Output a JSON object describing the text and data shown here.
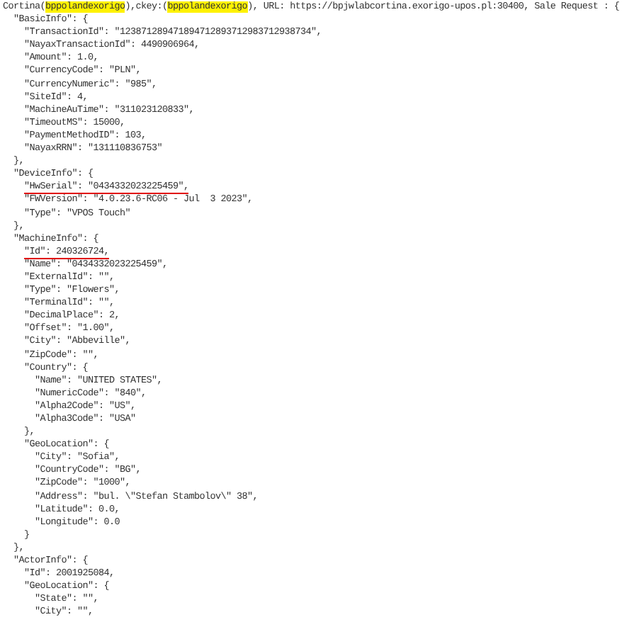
{
  "header": [
    {
      "text": "Cortina(",
      "highlighted": false
    },
    {
      "text": "bppolandexorigo",
      "highlighted": true
    },
    {
      "text": "),ckey:(",
      "highlighted": false
    },
    {
      "text": "bppolandexorigo",
      "highlighted": true
    },
    {
      "text": "), URL: https://bpjwlabcortina.exorigo-upos.pl:30400, Sale Request : {",
      "highlighted": false
    }
  ],
  "lines": [
    {
      "text": "  \"BasicInfo\": {",
      "underlined": false
    },
    {
      "text": "    \"TransactionId\": \"123871289471894712893712983712938734\",",
      "underlined": false
    },
    {
      "text": "    \"NayaxTransactionId\": 4490906964,",
      "underlined": false
    },
    {
      "text": "    \"Amount\": 1.0,",
      "underlined": false
    },
    {
      "text": "    \"CurrencyCode\": \"PLN\",",
      "underlined": false
    },
    {
      "text": "    \"CurrencyNumeric\": \"985\",",
      "underlined": false
    },
    {
      "text": "    \"SiteId\": 4,",
      "underlined": false
    },
    {
      "text": "    \"MachineAuTime\": \"311023120833\",",
      "underlined": false
    },
    {
      "text": "    \"TimeoutMS\": 15000,",
      "underlined": false
    },
    {
      "text": "    \"PaymentMethodID\": 103,",
      "underlined": false
    },
    {
      "text": "    \"NayaxRRN\": \"131110836753\"",
      "underlined": false
    },
    {
      "text": "  },",
      "underlined": false
    },
    {
      "text": "  \"DeviceInfo\": {",
      "underlined": false
    },
    {
      "text": "    \"HwSerial\": \"0434332023225459\",",
      "underlined": true
    },
    {
      "text": "    \"FWVersion\": \"4.0.23.6-RC06 - Jul  3 2023\",",
      "underlined": false
    },
    {
      "text": "    \"Type\": \"VPOS Touch\"",
      "underlined": false
    },
    {
      "text": "  },",
      "underlined": false
    },
    {
      "text": "  \"MachineInfo\": {",
      "underlined": false
    },
    {
      "text": "    \"Id\": 240326724,",
      "underlined": true
    },
    {
      "text": "    \"Name\": \"0434332023225459\",",
      "underlined": false
    },
    {
      "text": "    \"ExternalId\": \"\",",
      "underlined": false
    },
    {
      "text": "    \"Type\": \"Flowers\",",
      "underlined": false
    },
    {
      "text": "    \"TerminalId\": \"\",",
      "underlined": false
    },
    {
      "text": "    \"DecimalPlace\": 2,",
      "underlined": false
    },
    {
      "text": "    \"Offset\": \"1.00\",",
      "underlined": false
    },
    {
      "text": "    \"City\": \"Abbeville\",",
      "underlined": false
    },
    {
      "text": "    \"ZipCode\": \"\",",
      "underlined": false
    },
    {
      "text": "    \"Country\": {",
      "underlined": false
    },
    {
      "text": "      \"Name\": \"UNITED STATES\",",
      "underlined": false
    },
    {
      "text": "      \"NumericCode\": \"840\",",
      "underlined": false
    },
    {
      "text": "      \"Alpha2Code\": \"US\",",
      "underlined": false
    },
    {
      "text": "      \"Alpha3Code\": \"USA\"",
      "underlined": false
    },
    {
      "text": "    },",
      "underlined": false
    },
    {
      "text": "    \"GeoLocation\": {",
      "underlined": false
    },
    {
      "text": "      \"City\": \"Sofia\",",
      "underlined": false
    },
    {
      "text": "      \"CountryCode\": \"BG\",",
      "underlined": false
    },
    {
      "text": "      \"ZipCode\": \"1000\",",
      "underlined": false
    },
    {
      "text": "      \"Address\": \"bul. \\\"Stefan Stambolov\\\" 38\",",
      "underlined": false
    },
    {
      "text": "      \"Latitude\": 0.0,",
      "underlined": false
    },
    {
      "text": "      \"Longitude\": 0.0",
      "underlined": false
    },
    {
      "text": "    }",
      "underlined": false
    },
    {
      "text": "  },",
      "underlined": false
    },
    {
      "text": "  \"ActorInfo\": {",
      "underlined": false
    },
    {
      "text": "    \"Id\": 2001925084,",
      "underlined": false
    },
    {
      "text": "    \"GeoLocation\": {",
      "underlined": false
    },
    {
      "text": "      \"State\": \"\",",
      "underlined": false
    },
    {
      "text": "      \"City\": \"\",",
      "underlined": false
    }
  ]
}
